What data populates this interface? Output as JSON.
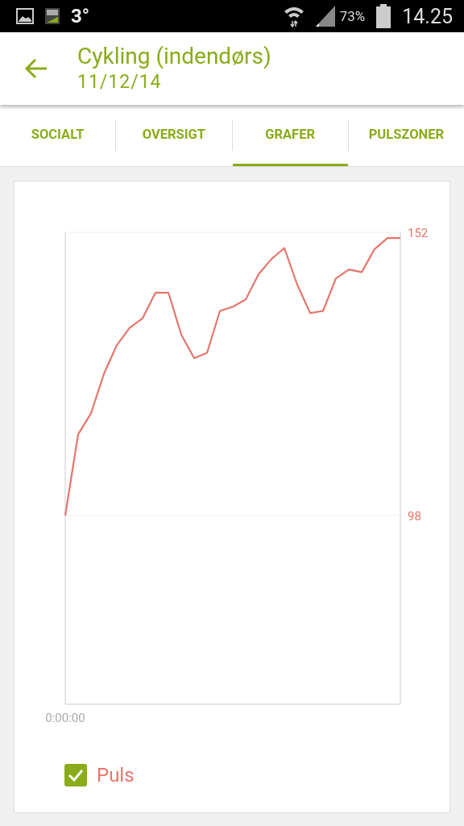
{
  "status_bar": {
    "temperature": "3°",
    "battery": "73%",
    "time": "14.25"
  },
  "header": {
    "title": "Cykling (indendørs)",
    "subtitle": "11/12/14"
  },
  "tabs": [
    {
      "label": "SOCIALT",
      "selected": false
    },
    {
      "label": "OVERSIGT",
      "selected": false
    },
    {
      "label": "GRAFER",
      "selected": true
    },
    {
      "label": "PULSZONER",
      "selected": false
    }
  ],
  "chart": {
    "chart_data": {
      "type": "line",
      "series": [
        {
          "name": "Puls",
          "color": "#e5766b",
          "values": [
            98,
            113.5,
            117.5,
            125,
            130.5,
            133.8,
            135.6,
            140.5,
            140.5,
            132.5,
            128,
            129,
            137,
            137.8,
            139.2,
            144,
            146.9,
            149,
            142,
            136.6,
            137,
            143.2,
            144.9,
            144.4,
            148.8,
            150.9,
            150.9
          ]
        }
      ],
      "ylim": [
        62,
        152
      ],
      "yticks": [
        {
          "value": 98,
          "label": "98"
        },
        {
          "value": 152,
          "label": "152"
        }
      ],
      "annotations": [
        {
          "text": "0:00:00"
        }
      ]
    },
    "legend": {
      "checked": true
    }
  }
}
